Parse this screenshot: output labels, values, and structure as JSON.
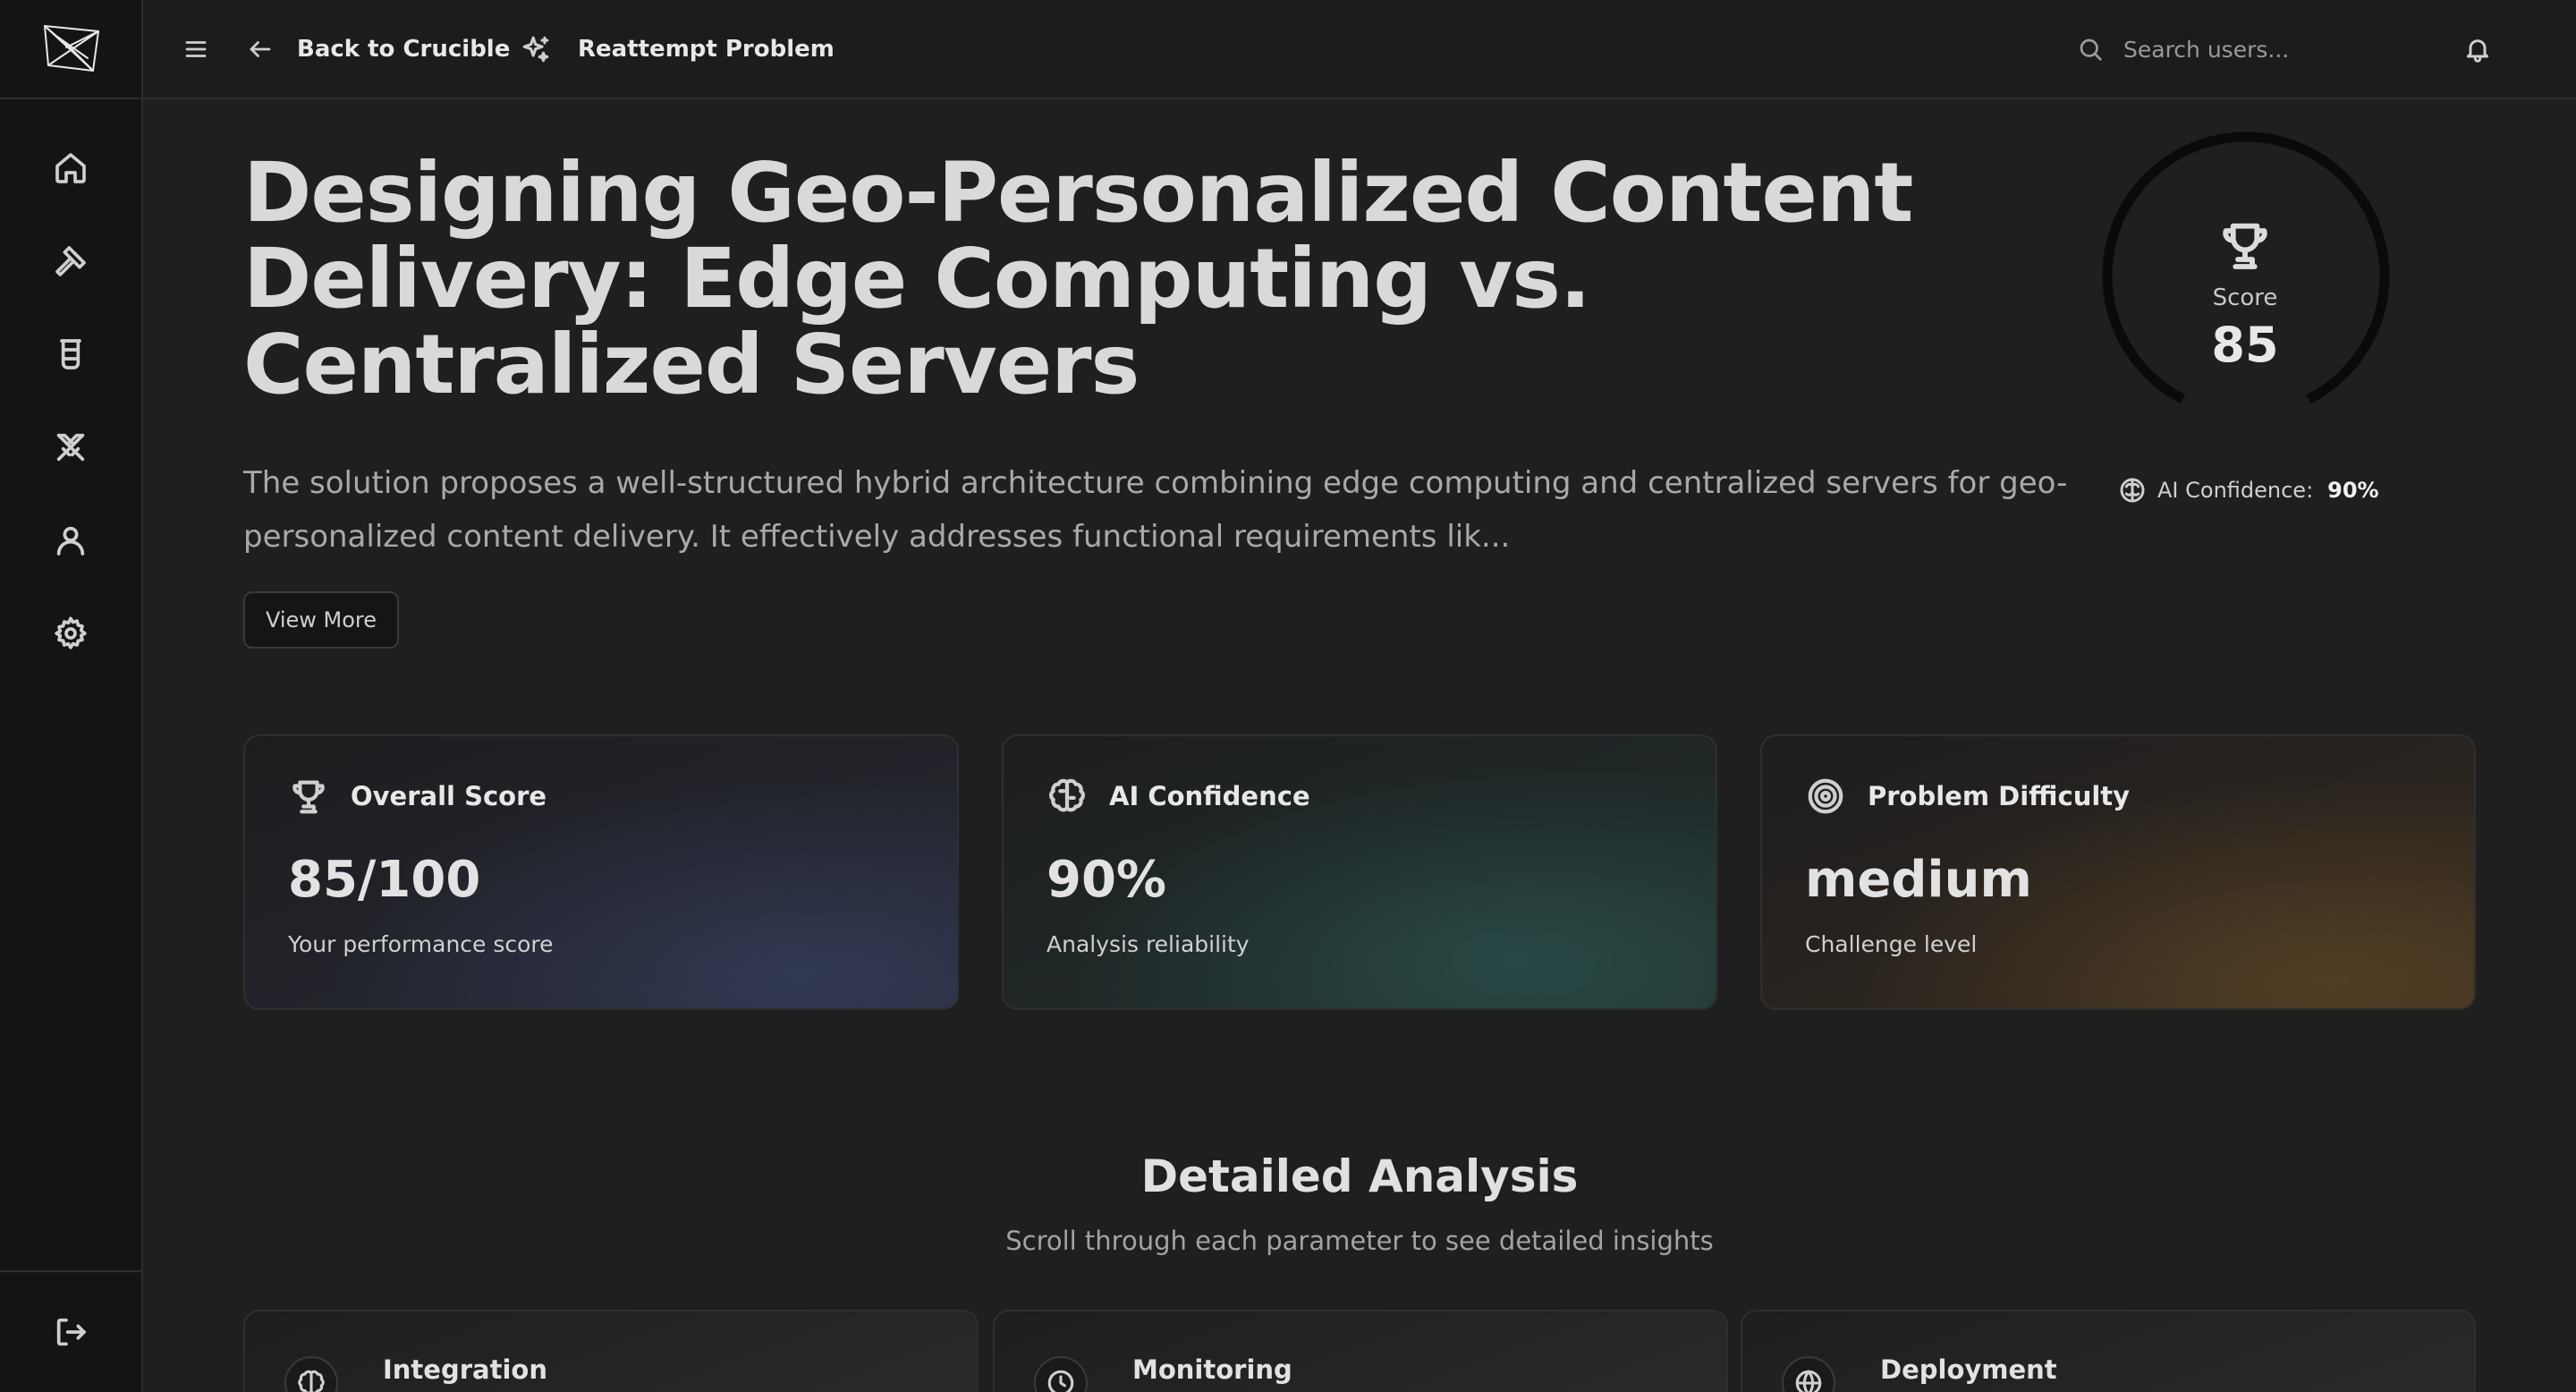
{
  "topbar": {
    "back_label": "Back to Crucible",
    "reattempt_label": "Reattempt Problem",
    "search_placeholder": "Search users..."
  },
  "sidebar": {
    "items": [
      {
        "name": "home",
        "icon": "home-icon"
      },
      {
        "name": "hammer",
        "icon": "hammer-icon"
      },
      {
        "name": "beaker",
        "icon": "beaker-icon"
      },
      {
        "name": "swords",
        "icon": "swords-icon"
      },
      {
        "name": "profile",
        "icon": "user-icon"
      },
      {
        "name": "settings",
        "icon": "gear-icon"
      }
    ],
    "logout_icon": "logout-icon"
  },
  "main": {
    "title": "Designing Geo-Personalized Content Delivery: Edge Computing vs. Centralized Servers",
    "summary": "The solution proposes a well-structured hybrid architecture combining edge computing and centralized servers for geo-personalized content delivery. It effectively addresses functional requirements lik...",
    "view_more_label": "View More",
    "score": {
      "label": "Score",
      "value": "85",
      "fraction": 0.85
    },
    "ai_confidence": {
      "label": "AI Confidence:",
      "value": "90%"
    }
  },
  "cards": [
    {
      "title": "Overall Score",
      "value": "85/100",
      "subtitle": "Your performance score",
      "icon": "trophy-icon"
    },
    {
      "title": "AI Confidence",
      "value": "90%",
      "subtitle": "Analysis reliability",
      "icon": "brain-icon"
    },
    {
      "title": "Problem Difficulty",
      "value": "medium",
      "subtitle": "Challenge level",
      "icon": "target-icon"
    }
  ],
  "analysis": {
    "title": "Detailed Analysis",
    "subtitle": "Scroll through each parameter to see detailed insights",
    "params": [
      {
        "label": "Integration",
        "icon": "brain-icon"
      },
      {
        "label": "Monitoring",
        "icon": "clock-icon"
      },
      {
        "label": "Deployment",
        "icon": "globe-icon"
      }
    ]
  },
  "colors": {
    "background": "#1f1f1f",
    "sidebar": "#141414",
    "ring": "#0a0a0a",
    "text": "#e8e8e8",
    "muted": "#a9a9a9"
  }
}
